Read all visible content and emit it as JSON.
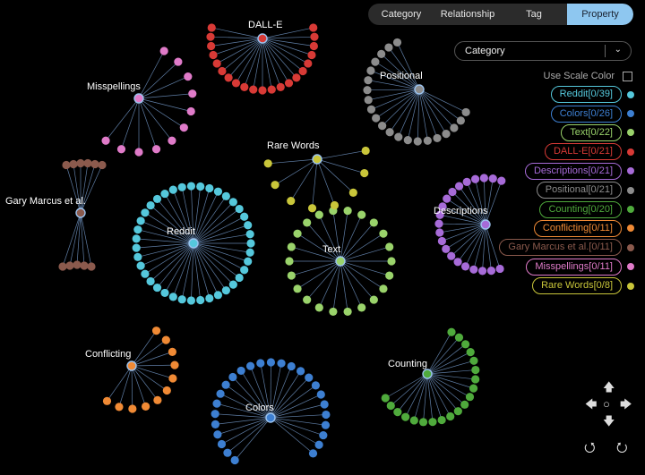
{
  "tabs": [
    "Category",
    "Relationship",
    "Tag",
    "Property"
  ],
  "active_tab": 3,
  "selector": {
    "value": "Category"
  },
  "scale_toggle": {
    "label": "Use Scale Color",
    "checked": false
  },
  "legend": [
    {
      "label": "Reddit[0/39]",
      "color": "#55c8dc"
    },
    {
      "label": "Colors[0/26]",
      "color": "#3d7fd1"
    },
    {
      "label": "Text[0/22]",
      "color": "#9ad36b"
    },
    {
      "label": "DALL-E[0/21]",
      "color": "#d83a36"
    },
    {
      "label": "Descriptions[0/21]",
      "color": "#a76bd8"
    },
    {
      "label": "Positional[0/21]",
      "color": "#8c8c8c"
    },
    {
      "label": "Counting[0/20]",
      "color": "#4faa3c"
    },
    {
      "label": "Conflicting[0/11]",
      "color": "#f08a35"
    },
    {
      "label": "Gary Marcus et al.[0/11]",
      "color": "#8b5a4d"
    },
    {
      "label": "Misspellings[0/11]",
      "color": "#e07bc9"
    },
    {
      "label": "Rare Words[0/8]",
      "color": "#c9c63a"
    }
  ],
  "clusters": [
    {
      "label": "Reddit",
      "count": 39,
      "color": "#55c8dc"
    },
    {
      "label": "Colors",
      "count": 26,
      "color": "#3d7fd1"
    },
    {
      "label": "Text",
      "count": 22,
      "color": "#9ad36b"
    },
    {
      "label": "DALL-E",
      "count": 21,
      "color": "#d83a36"
    },
    {
      "label": "Descriptions",
      "count": 21,
      "color": "#a76bd8"
    },
    {
      "label": "Positional",
      "count": 21,
      "color": "#8c8c8c"
    },
    {
      "label": "Counting",
      "count": 20,
      "color": "#4faa3c"
    },
    {
      "label": "Conflicting",
      "count": 11,
      "color": "#f08a35"
    },
    {
      "label": "Gary Marcus et al.",
      "count": 11,
      "color": "#8b5a4d"
    },
    {
      "label": "Misspellings",
      "count": 11,
      "color": "#e07bc9"
    },
    {
      "label": "Rare Words",
      "count": 8,
      "color": "#c9c63a"
    }
  ],
  "nav_icons": [
    "pan-up-icon",
    "pan-left-icon",
    "pan-center-icon",
    "pan-right-icon",
    "pan-down-icon",
    "rotate-left-icon",
    "rotate-right-icon"
  ]
}
